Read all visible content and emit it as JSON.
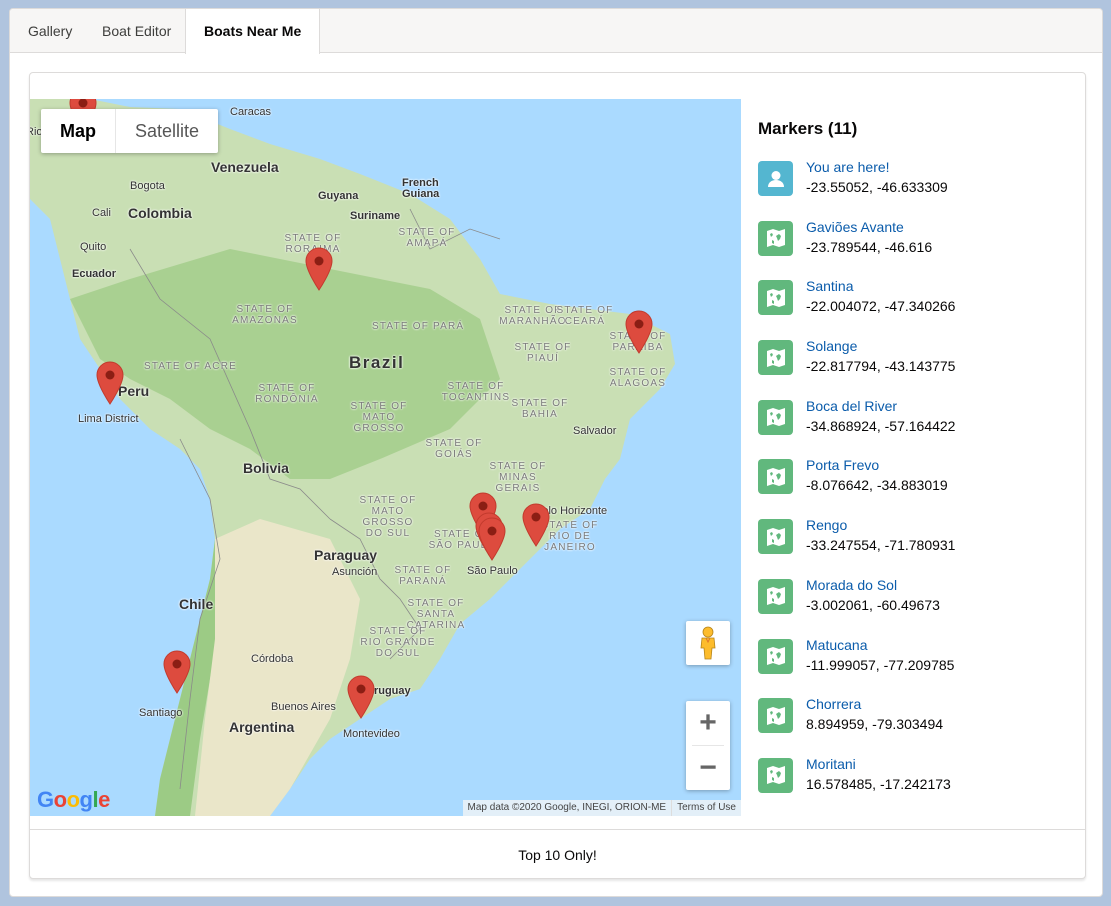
{
  "tabs": [
    {
      "label": "Gallery",
      "active": false
    },
    {
      "label": "Boat Editor",
      "active": false
    },
    {
      "label": "Boats Near Me",
      "active": true
    }
  ],
  "map": {
    "type_controls": {
      "map": "Map",
      "satellite": "Satellite",
      "selected": "Map"
    },
    "logo": "Google",
    "attribution": "Map data ©2020 Google, INEGI, ORION-ME",
    "terms": "Terms of Use",
    "zoom_in": "+",
    "zoom_out": "−",
    "icons": {
      "pegman": "pegman-icon",
      "pin": "map-pin-icon"
    },
    "labels": {
      "countries": [
        "Venezuela",
        "Colombia",
        "Ecuador",
        "Guyana",
        "Suriname",
        "French",
        "Guiana",
        "Peru",
        "Brazil",
        "Bolivia",
        "Paraguay",
        "Chile",
        "Argentina",
        "Uruguay"
      ],
      "cities": [
        "Caracas",
        "Bogota",
        "Cali",
        "Quito",
        "Lima District",
        "Salvador",
        "Belo Horizonte",
        "São Paulo",
        "Asunción",
        "Córdoba",
        "Buenos Aires",
        "Montevideo",
        "Santiago",
        "Rio"
      ],
      "states": [
        "STATE OF RORAIMA",
        "STATE OF AMAPÁ",
        "STATE OF AMAZONAS",
        "STATE OF PARÁ",
        "STATE OF MARANHÃO",
        "STATE OF CEARÁ",
        "STATE OF PIAUÍ",
        "STATE OF PARAÍBA",
        "STATE OF ALAGOAS",
        "STATE OF ACRE",
        "STATE OF RONDÔNIA",
        "STATE OF TOCANTINS",
        "STATE OF MATO GROSSO",
        "STATE OF BAHIA",
        "STATE OF GOIÁS",
        "STATE OF MINAS GERAIS",
        "STATE OF MATO GROSSO DO SUL",
        "STATE OF SÃO PAULO",
        "STATE OF RIO DE JANEIRO",
        "STATE OF PARANÁ",
        "STATE OF SANTA CATARINA",
        "STATE OF RIO GRANDE DO SUL"
      ]
    }
  },
  "markers": {
    "title": "Markers (11)",
    "colors": {
      "user": "#54b6d0",
      "boat": "#61b87d",
      "link": "#0b5cab",
      "pin": "#dd4b3e"
    },
    "items": [
      {
        "name": "You are here!",
        "coords": "-23.55052, -46.633309",
        "icon": "user-icon"
      },
      {
        "name": "Gaviões Avante",
        "coords": "-23.789544, -46.616",
        "icon": "map-icon"
      },
      {
        "name": "Santina",
        "coords": "-22.004072, -47.340266",
        "icon": "map-icon"
      },
      {
        "name": "Solange",
        "coords": "-22.817794, -43.143775",
        "icon": "map-icon"
      },
      {
        "name": "Boca del River",
        "coords": "-34.868924, -57.164422",
        "icon": "map-icon"
      },
      {
        "name": "Porta Frevo",
        "coords": "-8.076642, -34.883019",
        "icon": "map-icon"
      },
      {
        "name": "Rengo",
        "coords": "-33.247554, -71.780931",
        "icon": "map-icon"
      },
      {
        "name": "Morada do Sol",
        "coords": "-3.002061, -60.49673",
        "icon": "map-icon"
      },
      {
        "name": "Matucana",
        "coords": "-11.999057, -77.209785",
        "icon": "map-icon"
      },
      {
        "name": "Chorrera",
        "coords": "8.894959, -79.303494",
        "icon": "map-icon"
      },
      {
        "name": "Moritani",
        "coords": "16.578485, -17.242173",
        "icon": "map-icon"
      }
    ]
  },
  "footer": {
    "label": "Top 10 Only!"
  }
}
